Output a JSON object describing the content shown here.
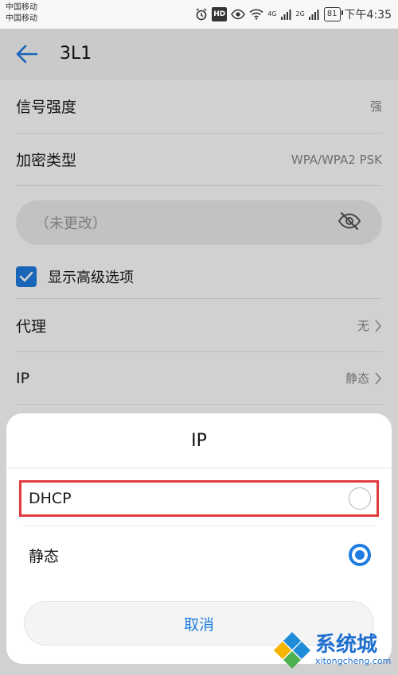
{
  "status_bar": {
    "carrier_1": "中国移动",
    "carrier_2": "中国移动",
    "hd_label": "HD",
    "net_1": "4G",
    "net_2": "2G",
    "battery": "81",
    "time": "下午4:35"
  },
  "app_bar": {
    "back_icon": "arrow-left-icon",
    "title": "3L1"
  },
  "settings": {
    "signal_label": "信号强度",
    "signal_value": "强",
    "encryption_label": "加密类型",
    "encryption_value": "WPA/WPA2 PSK",
    "password_placeholder": "（未更改）",
    "password_toggle_icon": "eye-off-icon",
    "show_advanced_label": "显示高级选项",
    "show_advanced_checked": true,
    "proxy_label": "代理",
    "proxy_value": "无",
    "ip_label": "IP",
    "ip_value": "静态"
  },
  "dialog": {
    "title": "IP",
    "options": [
      {
        "label": "DHCP",
        "selected": false
      },
      {
        "label": "静态",
        "selected": true
      }
    ],
    "cancel_label": "取消"
  },
  "watermark": {
    "title": "系统城",
    "url": "xitongcheng.com"
  },
  "colors": {
    "accent": "#1f7ce0",
    "highlight": "#e0393e"
  }
}
